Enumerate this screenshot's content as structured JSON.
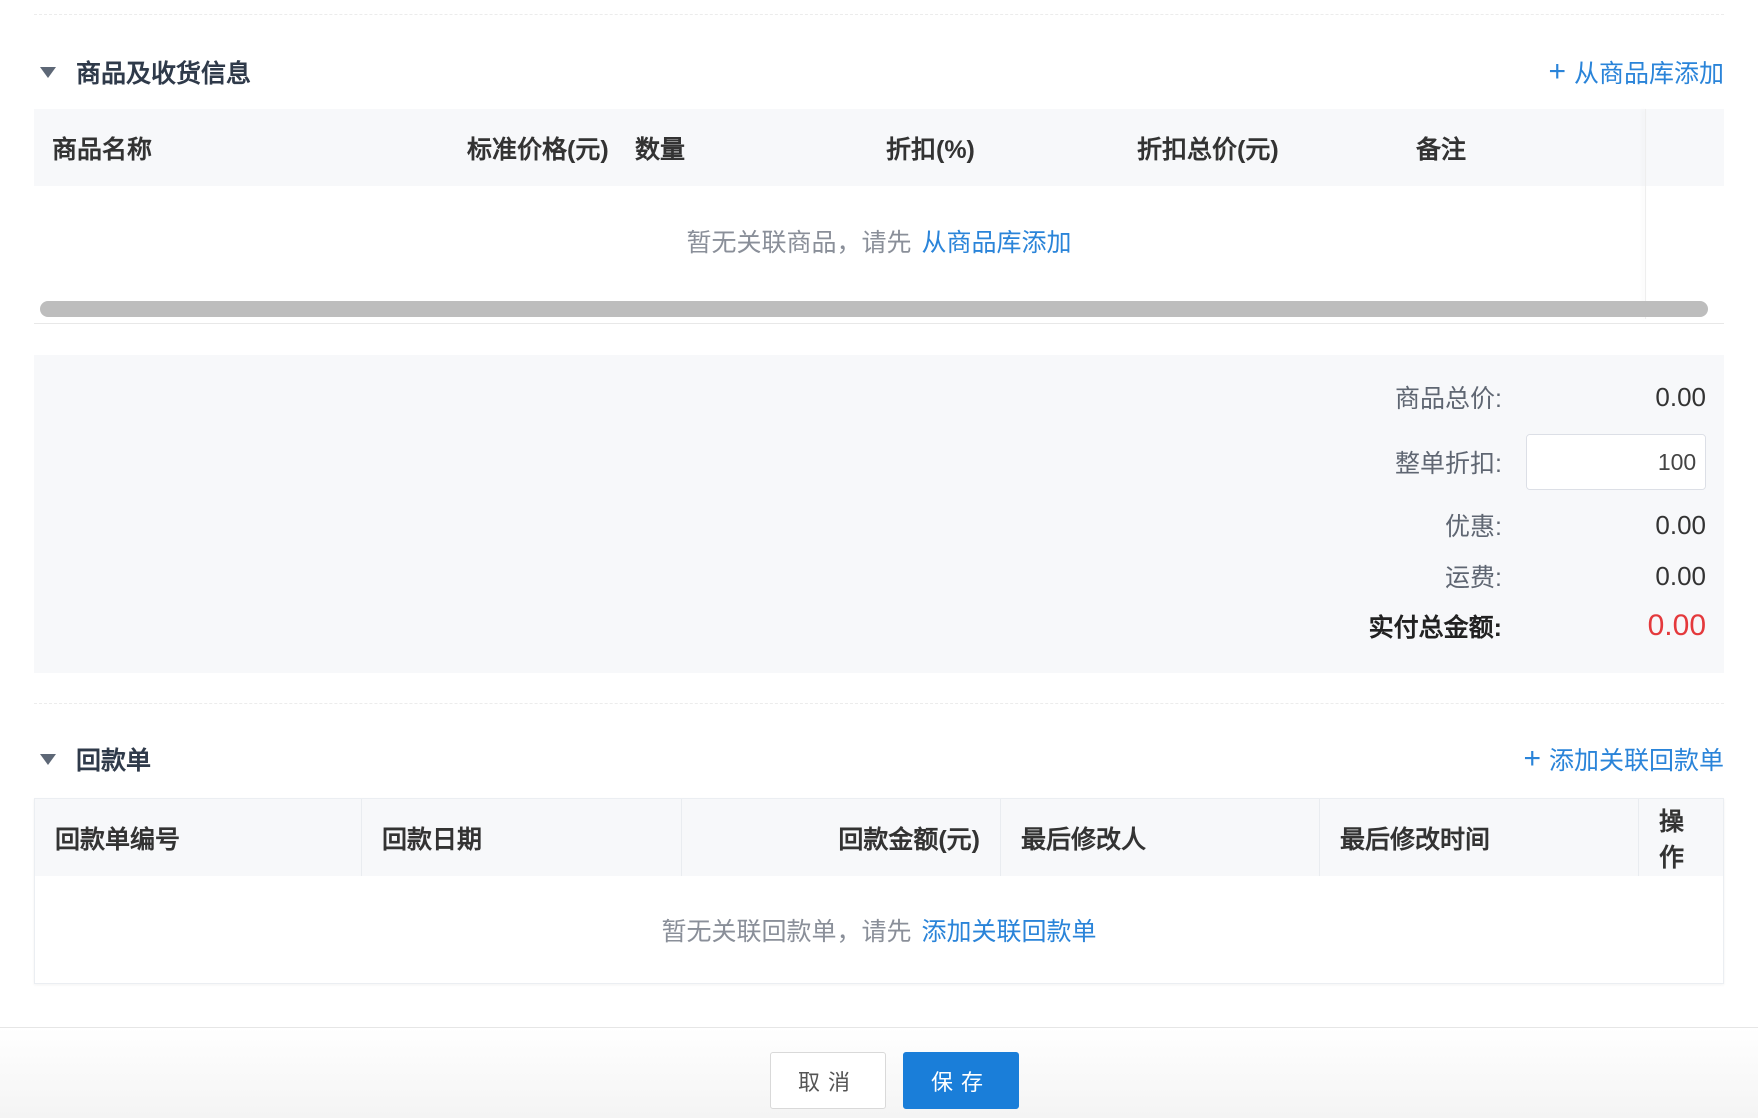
{
  "products_section": {
    "title": "商品及收货信息",
    "add_action": "从商品库添加",
    "columns": [
      "商品名称",
      "标准价格(元)",
      "数量",
      "折扣(%)",
      "折扣总价(元)",
      "备注"
    ],
    "empty_text": "暂无关联商品，请先",
    "empty_link": "从商品库添加"
  },
  "summary": {
    "total_label": "商品总价:",
    "total_value": "0.00",
    "discount_label": "整单折扣:",
    "discount_value": "100",
    "discount_suffix": "%",
    "promo_label": "优惠:",
    "promo_value": "0.00",
    "shipping_label": "运费:",
    "shipping_value": "0.00",
    "payable_label": "实付总金额:",
    "payable_value": "0.00",
    "payable_color": "#e4393c"
  },
  "payments_section": {
    "title": "回款单",
    "add_action": "添加关联回款单",
    "columns": [
      "回款单编号",
      "回款日期",
      "回款金额(元)",
      "最后修改人",
      "最后修改时间",
      "操作"
    ],
    "empty_text": "暂无关联回款单，请先",
    "empty_link": "添加关联回款单"
  },
  "footer": {
    "cancel_label": "取消",
    "save_label": "保存",
    "accent_color": "#1a7ed9"
  }
}
